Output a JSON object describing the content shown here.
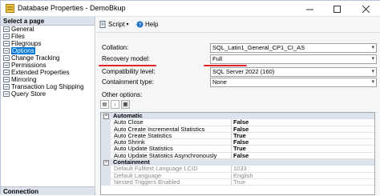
{
  "window": {
    "title": "Database Properties - DemoBkup"
  },
  "left_panel": {
    "header": "Select a page",
    "pages": [
      {
        "label": "General",
        "selected": false
      },
      {
        "label": "Files",
        "selected": false
      },
      {
        "label": "Filegroups",
        "selected": false
      },
      {
        "label": "Options",
        "selected": true
      },
      {
        "label": "Change Tracking",
        "selected": false
      },
      {
        "label": "Permissions",
        "selected": false
      },
      {
        "label": "Extended Properties",
        "selected": false
      },
      {
        "label": "Mirroring",
        "selected": false
      },
      {
        "label": "Transaction Log Shipping",
        "selected": false
      },
      {
        "label": "Query Store",
        "selected": false
      }
    ],
    "connection_header": "Connection"
  },
  "toolbar": {
    "script_label": "Script",
    "help_label": "Help"
  },
  "fields": {
    "collation": {
      "label": "Collation:",
      "value": "SQL_Latin1_General_CP1_CI_AS"
    },
    "recovery_model": {
      "label": "Recovery model:",
      "value": "Full"
    },
    "compatibility_level": {
      "label": "Compatibility level:",
      "value": "SQL Server 2022 (160)"
    },
    "containment_type": {
      "label": "Containment type:",
      "value": "None"
    }
  },
  "other_options_label": "Other options:",
  "grid": {
    "automatic": {
      "name": "Automatic",
      "rows": [
        {
          "name": "Auto Close",
          "value": "False"
        },
        {
          "name": "Auto Create Incremental Statistics",
          "value": "False"
        },
        {
          "name": "Auto Create Statistics",
          "value": "True"
        },
        {
          "name": "Auto Shrink",
          "value": "False"
        },
        {
          "name": "Auto Update Statistics",
          "value": "True"
        },
        {
          "name": "Auto Update Statistics Asynchronously",
          "value": "False"
        }
      ]
    },
    "containment": {
      "name": "Containment",
      "rows": [
        {
          "name": "Default Fulltext Language LCID",
          "value": "1033"
        },
        {
          "name": "Default Language",
          "value": "English"
        },
        {
          "name": "Nested Triggers Enabled",
          "value": "True"
        }
      ]
    }
  },
  "colors": {
    "selection": "#0078d7",
    "annotation": "#e0242a",
    "header_bg": "#dde3ec"
  }
}
